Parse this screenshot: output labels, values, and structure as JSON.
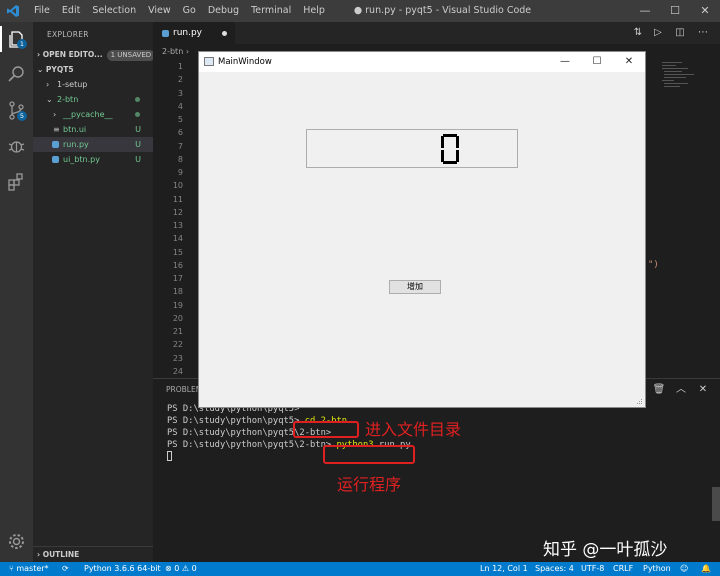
{
  "titlebar": {
    "menu": [
      "File",
      "Edit",
      "Selection",
      "View",
      "Go",
      "Debug",
      "Terminal",
      "Help"
    ],
    "title": "● run.py - pyqt5 - Visual Studio Code",
    "minimize": "—",
    "maximize": "☐",
    "close": "✕"
  },
  "activitybar": {
    "explorer_badge": "1",
    "scm_badge": "5"
  },
  "sidebar": {
    "title": "EXPLORER",
    "open_editors": "OPEN EDITO...",
    "unsaved_badge": "1 UNSAVED",
    "project": "PYQT5",
    "tree": [
      {
        "label": "1-setup",
        "chev": "›",
        "status": ""
      },
      {
        "label": "2-btn",
        "chev": "⌄",
        "status": ""
      },
      {
        "label": "__pycache__",
        "chev": "›",
        "status": ""
      },
      {
        "label": "btn.ui",
        "chev": "",
        "status": "U"
      },
      {
        "label": "run.py",
        "chev": "",
        "status": "U"
      },
      {
        "label": "ui_btn.py",
        "chev": "",
        "status": "U"
      }
    ],
    "outline": "OUTLINE"
  },
  "editor": {
    "tab_label": "run.py",
    "breadcrumb": "2-btn",
    "line_numbers": [
      "1",
      "2",
      "3",
      "4",
      "5",
      "6",
      "7",
      "8",
      "9",
      "10",
      "11",
      "12",
      "13",
      "14",
      "15",
      "16",
      "17",
      "18",
      "19",
      "20",
      "21",
      "22",
      "23",
      "24"
    ],
    "code_fragment": "\")"
  },
  "panel": {
    "title": "PROBLEMS",
    "lines": [
      "PS D:\\study\\python\\pyqt5>",
      "PS D:\\study\\python\\pyqt5>",
      "PS D:\\study\\python\\pyqt5\\2-btn>",
      "PS D:\\study\\python\\pyqt5\\2-btn>"
    ],
    "cmd1": "cd 2-btn",
    "cmd2_prog": "python3",
    "cmd2_arg": " run.py",
    "annotation1": "进入文件目录",
    "annotation2": "运行程序"
  },
  "statusbar": {
    "branch": "master*",
    "interpreter": "Python 3.6.6 64-bit",
    "problems": "⊗ 0 ⚠ 0",
    "position": "Ln 12, Col 1",
    "spaces": "Spaces: 4",
    "encoding": "UTF-8",
    "eol": "CRLF",
    "language": "Python"
  },
  "watermark": "知乎 @一叶孤沙",
  "mainwindow": {
    "title": "MainWindow",
    "minimize": "—",
    "maximize": "☐",
    "close": "✕",
    "lcd_value": 0,
    "button_label": "增加"
  },
  "colors": {
    "activitybar": "#333333",
    "sidebar": "#252526",
    "editor": "#1e1e1e",
    "statusbar": "#007acc",
    "annotation": "#e02020",
    "untracked": "#73c991"
  }
}
